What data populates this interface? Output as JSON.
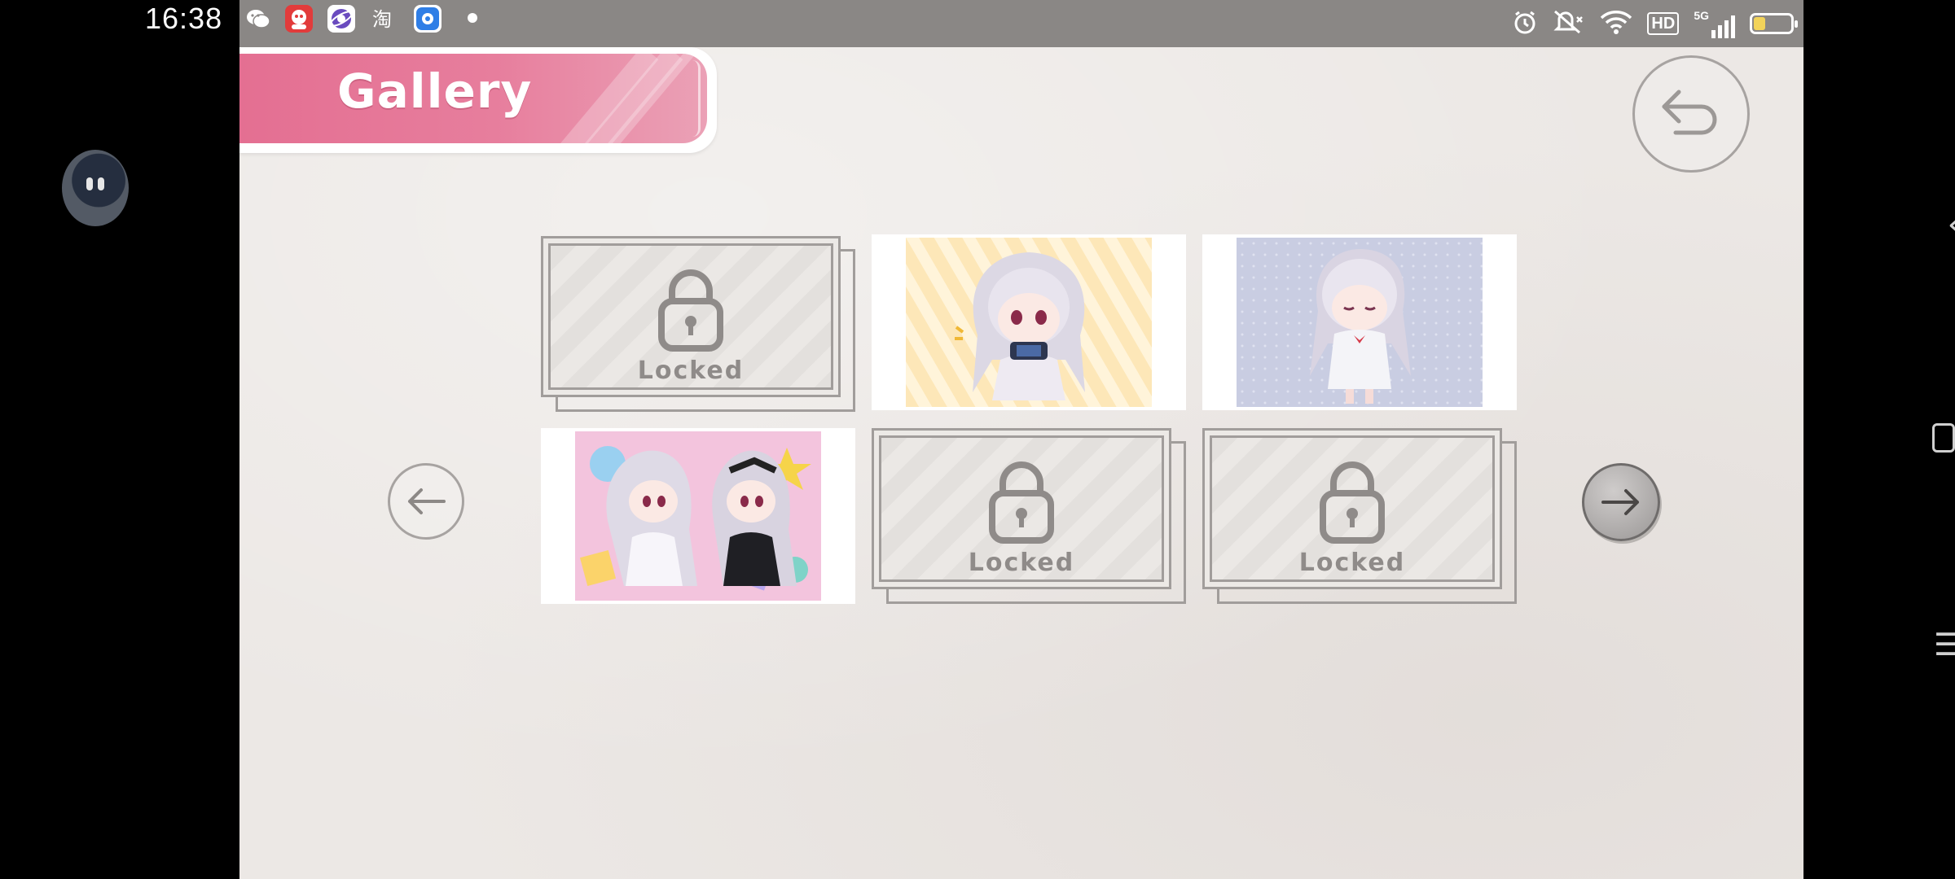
{
  "status_bar": {
    "time": "16:38",
    "notification_icons": [
      "wechat-icon",
      "app-icon-1",
      "app-icon-2",
      "taobao-icon",
      "app-icon-3",
      "dot-icon"
    ],
    "system_icons": [
      "alarm-icon",
      "mute-icon",
      "wifi-icon",
      "hd-icon",
      "5g-signal-icon",
      "battery-icon"
    ],
    "hd_label": "HD",
    "network_label": "5G",
    "battery_level_fraction": 0.25
  },
  "screen": {
    "title": "Gallery",
    "accent_color": "#e46f92",
    "tiles": [
      {
        "state": "locked",
        "label": "Locked"
      },
      {
        "state": "unlocked",
        "scene": "girl-with-game-console",
        "bg": "#fde7b8"
      },
      {
        "state": "unlocked",
        "scene": "girl-waving",
        "bg": "#c9cde2"
      },
      {
        "state": "unlocked",
        "scene": "two-girls-playing",
        "bg": "#f3c4dd"
      },
      {
        "state": "locked",
        "label": "Locked"
      },
      {
        "state": "locked",
        "label": "Locked"
      }
    ]
  },
  "icons": {
    "return": "return-arrow-icon",
    "prev": "arrow-left-icon",
    "next": "arrow-right-icon",
    "lock": "padlock-icon"
  }
}
